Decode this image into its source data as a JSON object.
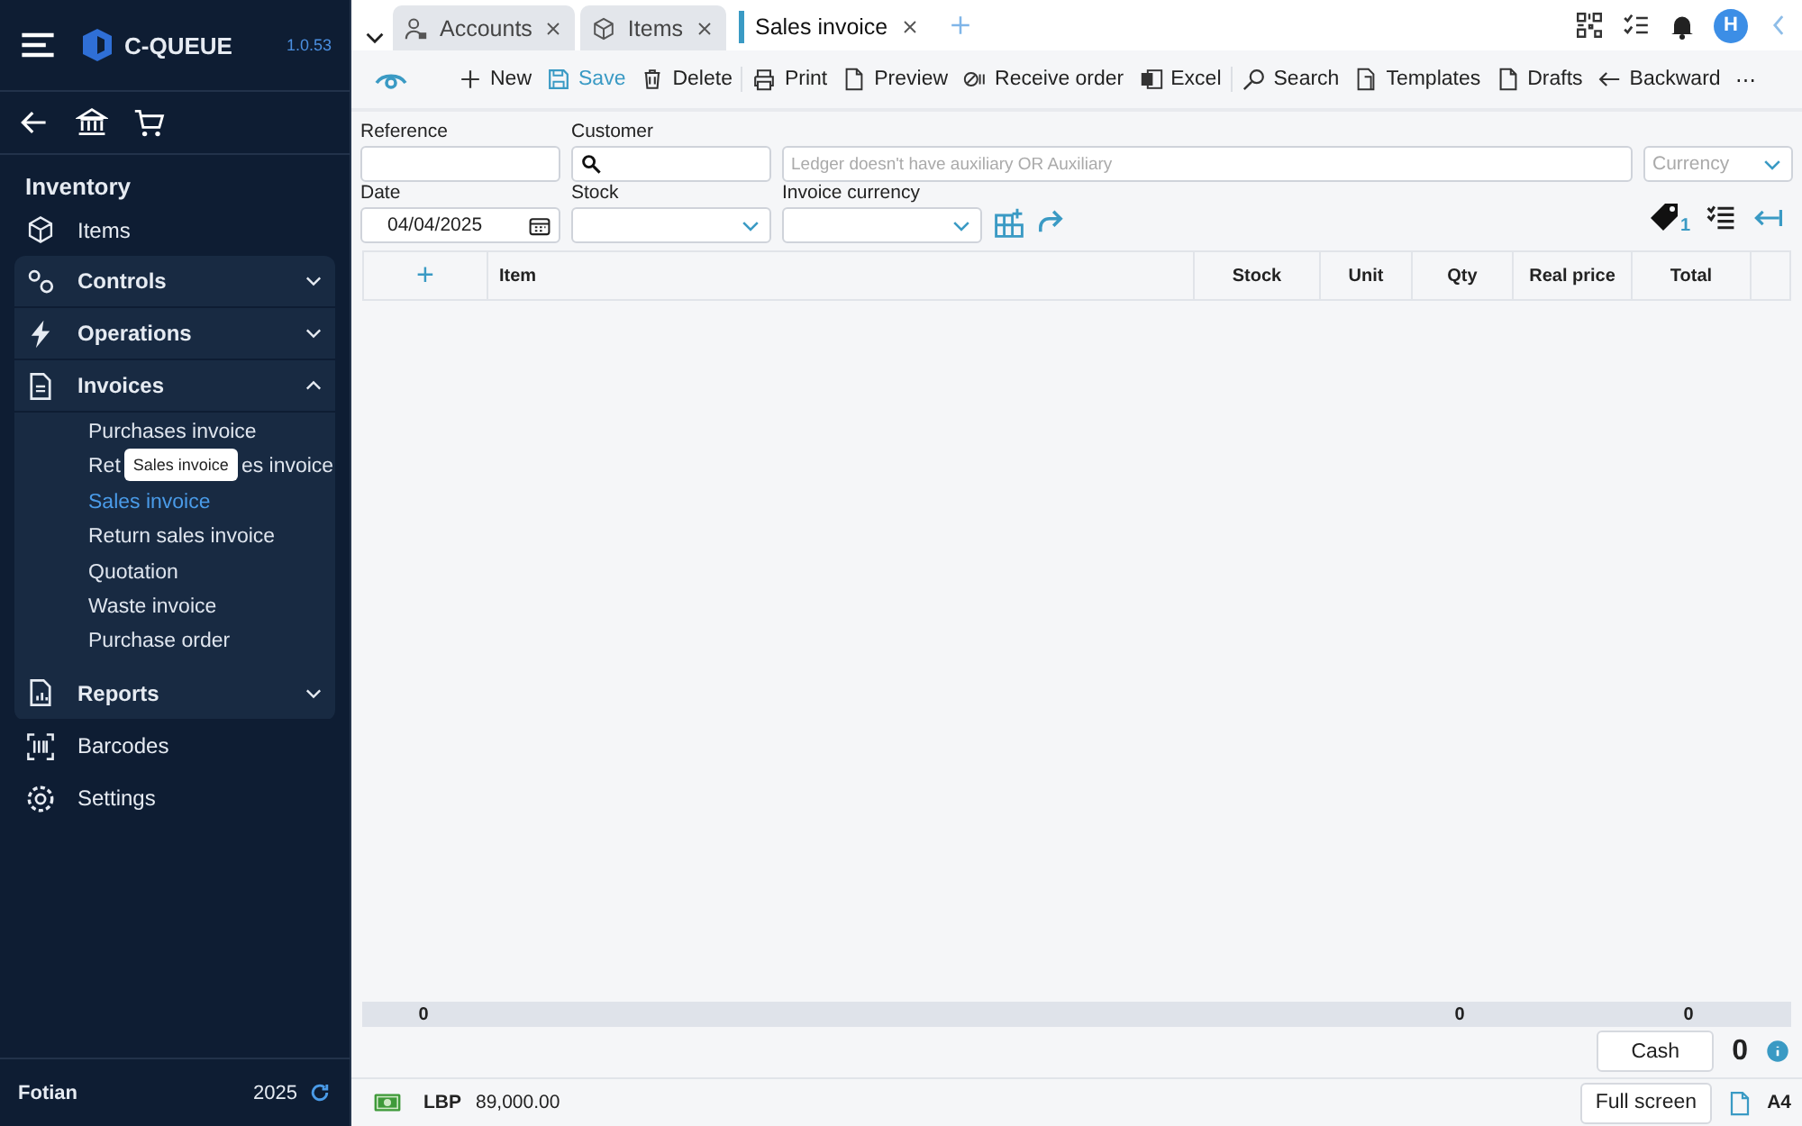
{
  "sidebar": {
    "app_name": "C-QUEUE",
    "version": "1.0.53",
    "section_title": "Inventory",
    "items": [
      {
        "kind": "link",
        "label": "Items"
      },
      {
        "kind": "group",
        "label": "Controls",
        "expanded": false
      },
      {
        "kind": "group",
        "label": "Operations",
        "expanded": false
      },
      {
        "kind": "group",
        "label": "Invoices",
        "expanded": true,
        "children": [
          {
            "label": "Purchases invoice",
            "selected": false
          },
          {
            "label_start": "Ret",
            "tooltip": "Sales invoice",
            "label_end": "es invoice",
            "selected": false
          },
          {
            "label": "Sales invoice",
            "selected": true
          },
          {
            "label": "Return sales invoice",
            "selected": false
          },
          {
            "label": "Quotation",
            "selected": false
          },
          {
            "label": "Waste invoice",
            "selected": false
          },
          {
            "label": "Purchase order",
            "selected": false
          }
        ]
      },
      {
        "kind": "group",
        "label": "Reports",
        "expanded": false
      },
      {
        "kind": "link",
        "label": "Barcodes"
      },
      {
        "kind": "link",
        "label": "Settings"
      }
    ],
    "footer": {
      "user": "Fotian",
      "year": "2025"
    }
  },
  "tabs": [
    {
      "label": "Accounts",
      "selected": false
    },
    {
      "label": "Items",
      "selected": false
    },
    {
      "label": "Sales invoice",
      "selected": true
    }
  ],
  "avatar": "H",
  "toolbar": [
    [
      {
        "kind": "new",
        "label": "New",
        "highlighted": false
      },
      {
        "kind": "save",
        "label": "Save",
        "highlighted": true
      },
      {
        "kind": "delete",
        "label": "Delete",
        "highlighted": false
      }
    ],
    [
      {
        "kind": "print",
        "label": "Print",
        "highlighted": false
      },
      {
        "kind": "preview",
        "label": "Preview",
        "highlighted": false
      },
      {
        "kind": "receive",
        "label": "Receive order",
        "highlighted": false
      },
      {
        "kind": "excel",
        "label": "Excel",
        "highlighted": false
      }
    ],
    [
      {
        "kind": "search",
        "label": "Search",
        "highlighted": false
      },
      {
        "kind": "templates",
        "label": "Templates",
        "highlighted": false
      },
      {
        "kind": "drafts",
        "label": "Drafts",
        "highlighted": false
      },
      {
        "kind": "backward",
        "label": "Backward",
        "highlighted": false
      },
      {
        "kind": "more",
        "label": "⋯",
        "highlighted": false
      }
    ]
  ],
  "form": {
    "reference": {
      "label": "Reference"
    },
    "customer": {
      "label": "Customer"
    },
    "ledger": {
      "placeholder": "Ledger doesn't have auxiliary OR Auxiliary"
    },
    "currency": {
      "placeholder": "Currency"
    },
    "date": {
      "label": "Date",
      "value": "04/04/2025"
    },
    "stock": {
      "label": "Stock"
    },
    "invoice_currency": {
      "label": "Invoice currency"
    },
    "tag_count": "1"
  },
  "table": {
    "columns": [
      {
        "kind": "add",
        "label": "+",
        "total": "0"
      },
      {
        "kind": "text",
        "label": "Item"
      },
      {
        "kind": "number",
        "label": "Stock"
      },
      {
        "kind": "number",
        "label": "Unit"
      },
      {
        "kind": "number",
        "label": "Qty",
        "total": "0"
      },
      {
        "kind": "number",
        "label": "Real price"
      },
      {
        "kind": "number",
        "label": "Total",
        "total": "0"
      }
    ]
  },
  "payment": {
    "button": "Cash",
    "amount": "0"
  },
  "status_bar": {
    "currency": "LBP",
    "balance": "89,000.00",
    "fullscreen": "Full screen",
    "paper": "A4"
  }
}
